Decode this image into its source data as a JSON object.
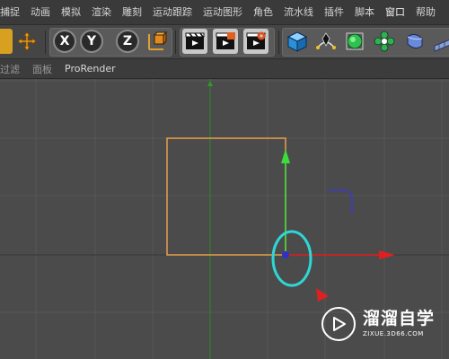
{
  "menubar": {
    "items": [
      "捕捉",
      "动画",
      "模拟",
      "渲染",
      "雕刻",
      "运动跟踪",
      "运动图形",
      "角色",
      "流水线",
      "插件",
      "脚本",
      "窗口",
      "帮助"
    ]
  },
  "toolbar": {
    "axis_x": "X",
    "axis_y": "Y",
    "axis_z": "Z"
  },
  "subbar": {
    "items": [
      "过滤",
      "面板",
      "ProRender"
    ]
  },
  "viewport": {
    "colors": {
      "spline": "#e8a04a",
      "y_axis": "#3ddc3d",
      "x_axis": "#e02020",
      "z_indicator": "#3a3acc",
      "highlight_ring": "#2ed6d6",
      "grid": "#5a5a5a"
    }
  },
  "watermark": {
    "title": "溜溜自学",
    "url": "ZIXUE.3D66.COM"
  }
}
